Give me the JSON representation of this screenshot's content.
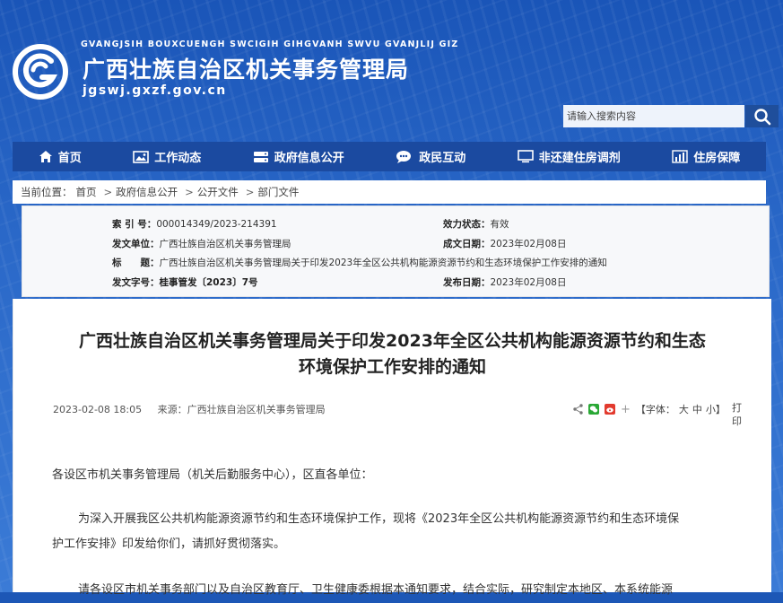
{
  "header": {
    "pinyin": "GVANGJSIH BOUXCUENGH SWCIGIH GIHGVANH SWVU GVANJLIJ GIZ",
    "site_name": "广西壮族自治区机关事务管理局",
    "domain": "jgswj.gxzf.gov.cn"
  },
  "search": {
    "placeholder": "请输入搜索内容"
  },
  "nav": [
    {
      "label": "首页",
      "icon": "home-icon"
    },
    {
      "label": "工作动态",
      "icon": "image-icon"
    },
    {
      "label": "政府信息公开",
      "icon": "database-icon"
    },
    {
      "label": "政民互动",
      "icon": "chat-icon"
    },
    {
      "label": "非还建住房调剂",
      "icon": "monitor-icon"
    },
    {
      "label": "住房保障",
      "icon": "bar-chart-icon"
    }
  ],
  "breadcrumb": {
    "prefix": "当前位置：",
    "items": [
      "首页",
      "政府信息公开",
      "公开文件",
      "部门文件"
    ]
  },
  "meta": {
    "index_label": "索 引 号：",
    "index_value": "000014349/2023-214391",
    "validity_label": "效力状态：",
    "validity_value": "有效",
    "issuer_label": "发文单位：",
    "issuer_value": "广西壮族自治区机关事务管理局",
    "created_label": "成文日期：",
    "created_value": "2023年02月08日",
    "title_label": "标　　题：",
    "title_value": "广西壮族自治区机关事务管理局关于印发2023年全区公共机构能源资源节约和生态环境保护工作安排的通知",
    "docno_label": "发文字号：",
    "docno_value": "桂事管发〔2023〕7号",
    "published_label": "发布日期：",
    "published_value": "2023年02月08日"
  },
  "article": {
    "title_line1": "广西壮族自治区机关事务管理局关于印发2023年全区公共机构能源资源节约和生态",
    "title_line2": "环境保护工作安排的通知",
    "datetime": "2023-02-08 18:05",
    "source": "来源：广西壮族自治区机关事务管理局",
    "font_label": "【字体：",
    "font_large": "大",
    "font_medium": "中",
    "font_small": "小】",
    "print_label": "打印",
    "salutation": "各设区市机关事务管理局（机关后勤服务中心），区直各单位：",
    "para1_line1": "为深入开展我区公共机构能源资源节约和生态环境保护工作，现将《2023年全区公共机构能源资源节约和生态环境保",
    "para1_line2": "护工作安排》印发给你们，请抓好贯彻落实。",
    "para2_line1": "请各设区市机关事务部门以及自治区教育厅、卫生健康委根据本通知要求，结合实际，研究制定本地区、本系统能源"
  },
  "colors": {
    "nav_bg": "#1b4aa0",
    "header_bg": "#1d57b6",
    "search_btn": "#1f4e9b"
  }
}
